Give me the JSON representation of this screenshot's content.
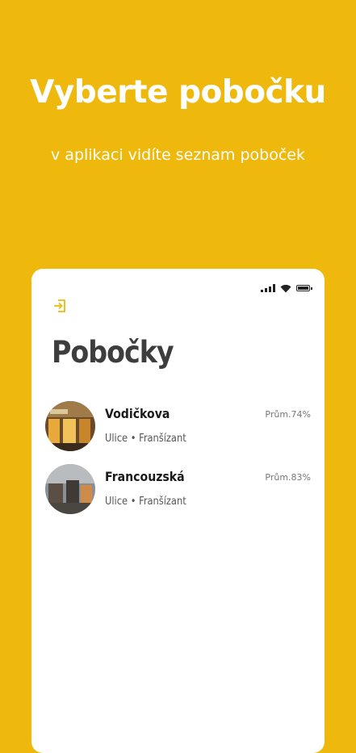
{
  "promo": {
    "headline": "Vyberte pobočku",
    "subline": "v aplikaci vidíte seznam poboček"
  },
  "colors": {
    "background": "#EEB80C",
    "accent": "#EEB80C",
    "title": "#3d3d3d"
  },
  "app": {
    "title": "Pobočky",
    "logout_icon": "logout-icon",
    "branches": [
      {
        "name": "Vodičkova",
        "meta": "Ulice • Franšízant",
        "stat": "Prům.74%"
      },
      {
        "name": "Francouzská",
        "meta": "Ulice • Franšízant",
        "stat": "Prům.83%"
      }
    ]
  }
}
